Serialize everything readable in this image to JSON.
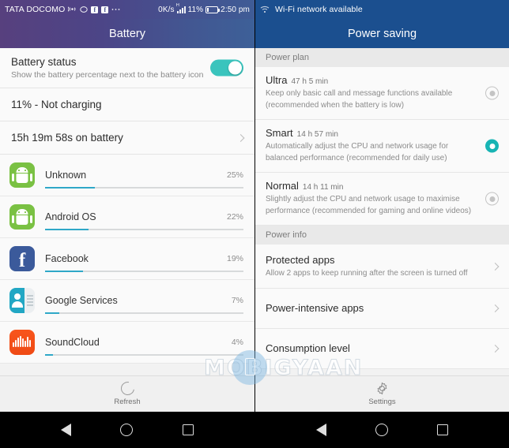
{
  "left": {
    "statusbar": {
      "carrier": "TATA DOCOMO",
      "netspeed": "0K/s",
      "network_type": "H",
      "battery_pct": "11%",
      "time": "2:50 pm",
      "icons": [
        "broadcast-icon",
        "chat-icon",
        "facebook-icon",
        "facebook-icon",
        "more-icon"
      ]
    },
    "title": "Battery",
    "battery_status": {
      "title": "Battery status",
      "subtitle": "Show the battery percentage next to the battery icon",
      "toggle_on": true
    },
    "charge_row": "11% - Not charging",
    "uptime_row": "15h 19m 58s on battery",
    "apps": [
      {
        "name": "Unknown",
        "pct": "25%",
        "value": 25,
        "icon": "android-icon"
      },
      {
        "name": "Android OS",
        "pct": "22%",
        "value": 22,
        "icon": "android-icon"
      },
      {
        "name": "Facebook",
        "pct": "19%",
        "value": 19,
        "icon": "facebook-icon"
      },
      {
        "name": "Google Services",
        "pct": "7%",
        "value": 7,
        "icon": "contacts-icon"
      },
      {
        "name": "SoundCloud",
        "pct": "4%",
        "value": 4,
        "icon": "soundcloud-icon"
      }
    ],
    "action": {
      "label": "Refresh",
      "icon": "refresh-icon"
    }
  },
  "right": {
    "statusbar": {
      "notification": "Wi-Fi network available",
      "icon": "wifi-icon"
    },
    "title": "Power saving",
    "sections": [
      {
        "header": "Power plan"
      },
      {
        "header": "Power info"
      }
    ],
    "plans": [
      {
        "name": "Ultra",
        "duration": "47 h 5 min",
        "description": "Keep only basic call and message functions available (recommended when the battery is low)",
        "selected": false
      },
      {
        "name": "Smart",
        "duration": "14 h 57 min",
        "description": "Automatically adjust the CPU and network usage for balanced performance (recommended for daily use)",
        "selected": true
      },
      {
        "name": "Normal",
        "duration": "14 h 11 min",
        "description": "Slightly adjust the CPU and network usage to maximise performance (recommended for gaming and online videos)",
        "selected": false
      }
    ],
    "info_items": [
      {
        "title": "Protected apps",
        "subtitle": "Allow 2 apps to keep running after the screen is turned off"
      },
      {
        "title": "Power-intensive apps",
        "subtitle": ""
      },
      {
        "title": "Consumption level",
        "subtitle": ""
      }
    ],
    "action": {
      "label": "Settings",
      "icon": "gear-icon"
    }
  },
  "watermark": {
    "text": "MOBIGYAAN"
  },
  "colors": {
    "accent_teal": "#18b4b4",
    "progress_blue": "#2fa8c8",
    "header_purple": "#57407e",
    "header_blue": "#1b4f8f"
  },
  "navbar": {
    "back": "back-icon",
    "home": "home-icon",
    "recents": "recents-icon"
  }
}
